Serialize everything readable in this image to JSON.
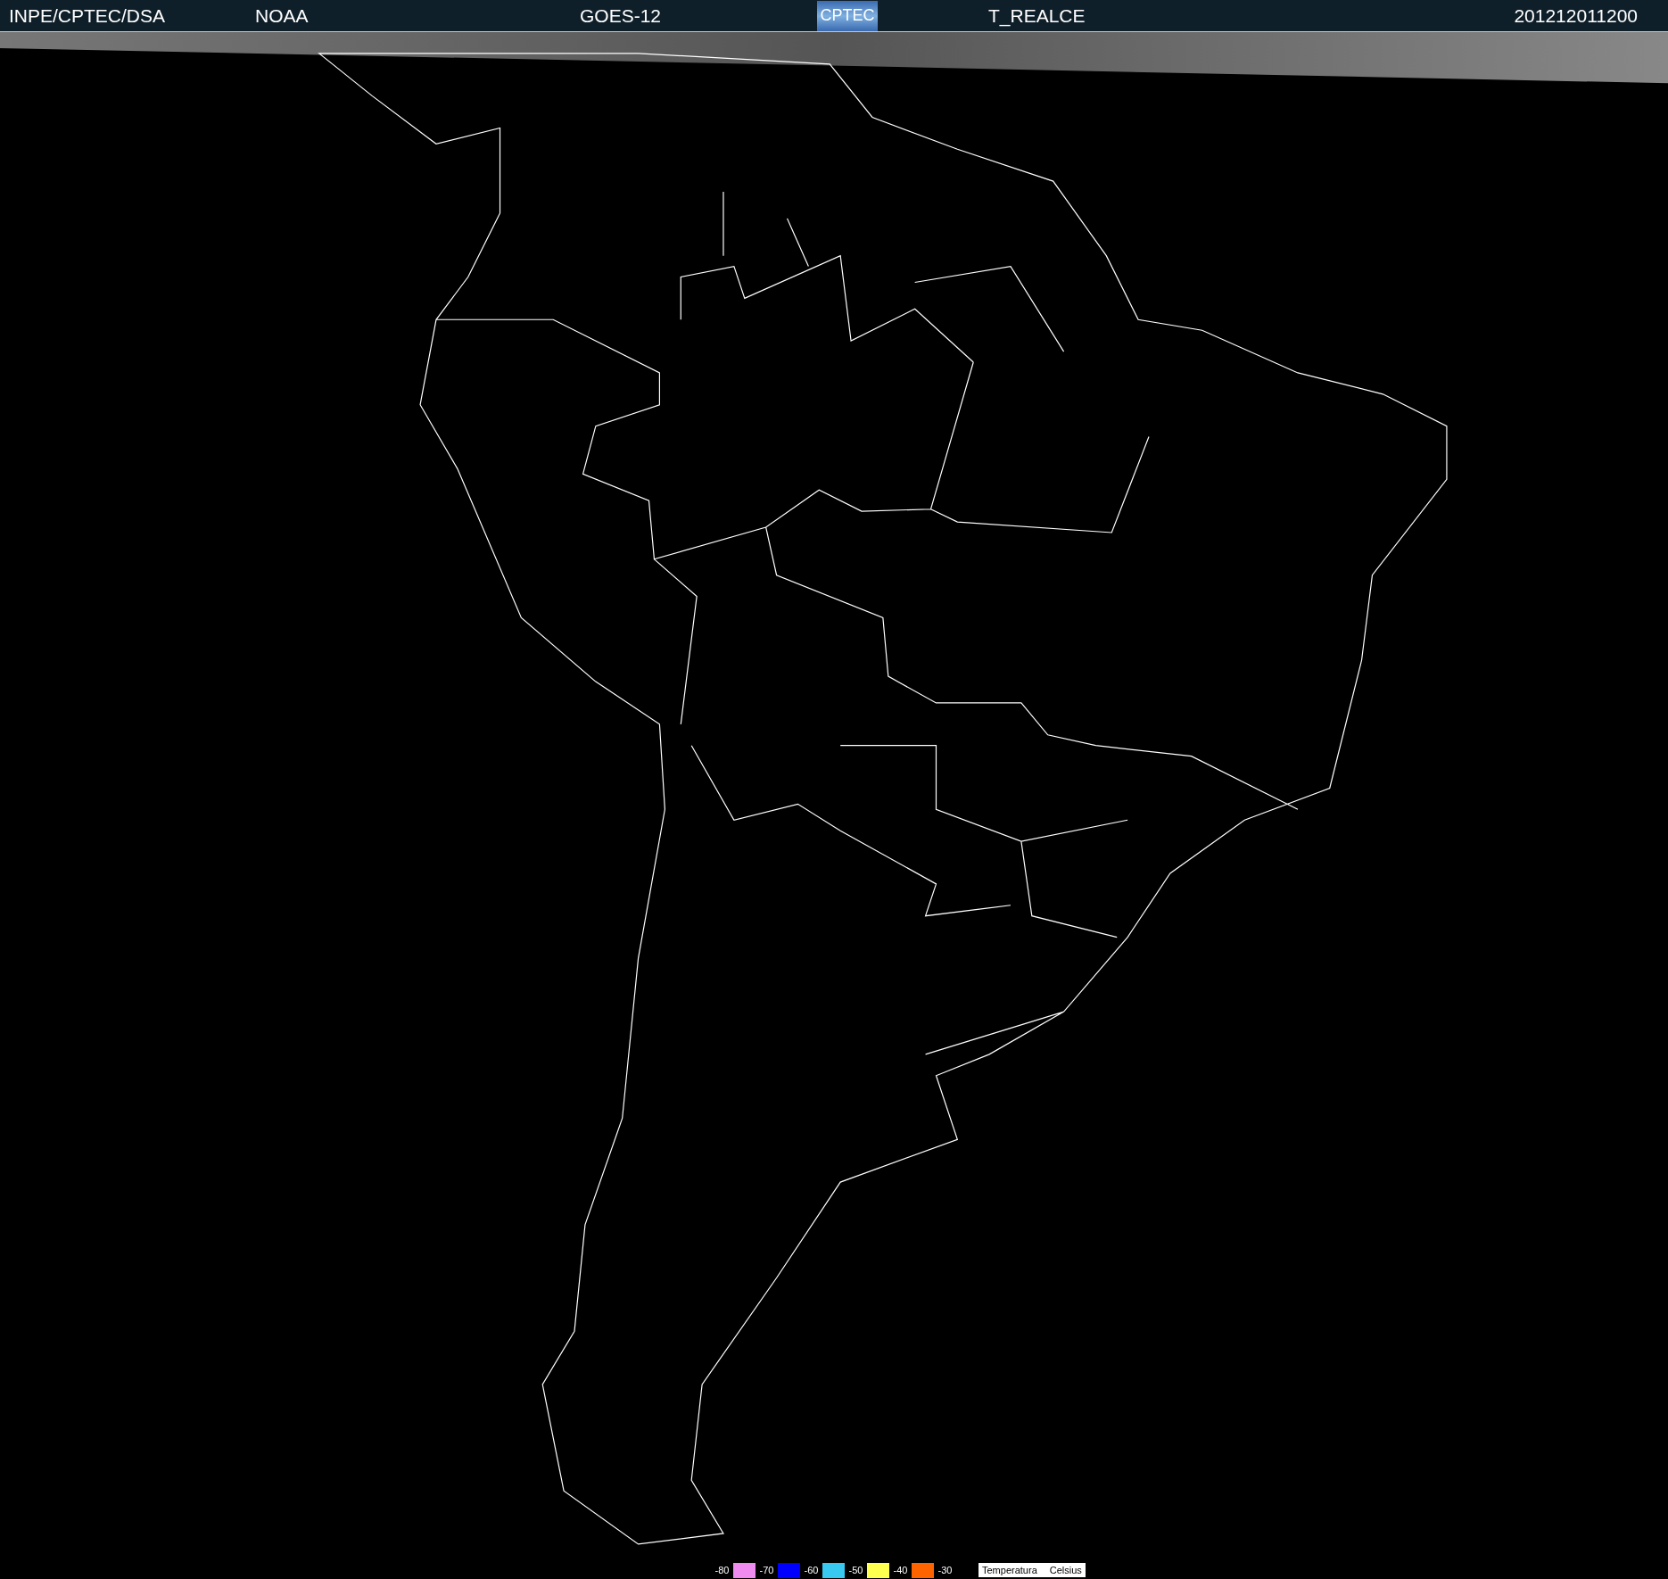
{
  "header": {
    "agency": "INPE/CPTEC/DSA",
    "source": "NOAA",
    "satellite": "GOES-12",
    "logo_text": "CPTEC",
    "product": "T_REALCE",
    "timestamp": "201212011200"
  },
  "legend": {
    "stops": [
      {
        "label": "-80",
        "color": "#f08cf0"
      },
      {
        "label": "-70",
        "color": "#0000ff"
      },
      {
        "label": "-60",
        "color": "#38c8f0"
      },
      {
        "label": "-50",
        "color": "#ffff50"
      },
      {
        "label": "-40",
        "color": "#ff6400"
      },
      {
        "label": "-30"
      }
    ],
    "caption": "Temperatura",
    "unit": "Celsius"
  }
}
